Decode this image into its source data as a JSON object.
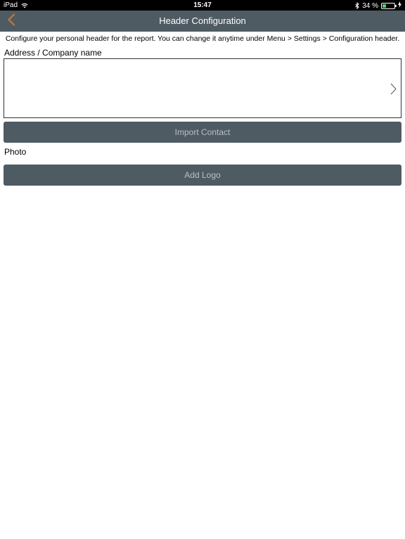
{
  "status_bar": {
    "device": "iPad",
    "time": "15:47",
    "battery_percent": "34 %",
    "battery_level": 0.34,
    "battery_color": "#4cd964"
  },
  "nav": {
    "title": "Header Configuration",
    "back_icon": "chevron-left-icon",
    "accent_color": "#c8793a",
    "bar_color": "#4f5b63"
  },
  "form": {
    "intro": "Configure your personal header for the report. You can change it anytime under Menu > Settings > Configuration header.",
    "address_label": "Address / Company name",
    "address_value": "",
    "import_button": "Import Contact",
    "photo_label": "Photo",
    "logo_button": "Add Logo"
  }
}
